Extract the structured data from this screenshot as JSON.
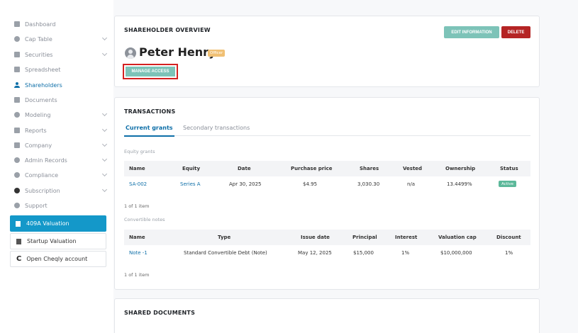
{
  "sidebar": {
    "items": [
      {
        "label": "Dashboard",
        "icon": "dashboard-icon",
        "has_chevron": false
      },
      {
        "label": "Cap Table",
        "icon": "pie-chart-icon",
        "has_chevron": true
      },
      {
        "label": "Securities",
        "icon": "document-icon",
        "has_chevron": true
      },
      {
        "label": "Spreadsheet",
        "icon": "spreadsheet-icon",
        "has_chevron": false
      },
      {
        "label": "Shareholders",
        "icon": "person-icon",
        "has_chevron": false
      },
      {
        "label": "Documents",
        "icon": "folder-icon",
        "has_chevron": false
      },
      {
        "label": "Modeling",
        "icon": "lightbulb-icon",
        "has_chevron": true
      },
      {
        "label": "Reports",
        "icon": "report-icon",
        "has_chevron": true
      },
      {
        "label": "Company",
        "icon": "company-icon",
        "has_chevron": true
      },
      {
        "label": "Admin Records",
        "icon": "pen-icon",
        "has_chevron": true
      },
      {
        "label": "Compliance",
        "icon": "compliance-icon",
        "has_chevron": true
      },
      {
        "label": "Subscription",
        "icon": "info-icon",
        "has_chevron": true
      },
      {
        "label": "Support",
        "icon": "support-icon",
        "has_chevron": false
      }
    ],
    "btn_409a": "409A Valuation",
    "btn_startup": "Startup Valuation",
    "btn_cheqly": "Open Cheqly account"
  },
  "overview": {
    "title": "SHAREHOLDER OVERVIEW",
    "edit_label": "EDIT INFORMATION",
    "delete_label": "DELETE",
    "name": "Peter Henry",
    "badge": "Officer",
    "manage_label": "MANAGE ACCESS"
  },
  "transactions": {
    "title": "TRANSACTIONS",
    "tabs": [
      "Current grants",
      "Secondary transactions"
    ],
    "equity_label": "Equity grants",
    "equity_headers": [
      "Name",
      "Equity",
      "Date",
      "Purchase price",
      "Shares",
      "Vested",
      "Ownership",
      "Status"
    ],
    "equity_rows": [
      {
        "name": "SA-002",
        "equity": "Series A",
        "date": "Apr 30, 2025",
        "price": "$4.95",
        "shares": "3,030.30",
        "vested": "n/a",
        "ownership": "13.4499%",
        "status": "Active"
      }
    ],
    "equity_count": "1 of 1 item",
    "convertible_label": "Convertible notes",
    "conv_headers": [
      "Name",
      "Type",
      "Issue date",
      "Principal",
      "Interest",
      "Valuation cap",
      "Discount"
    ],
    "conv_rows": [
      {
        "name": "Note -1",
        "type": "Standard Convertible Debt (Note)",
        "issue_date": "May 12, 2025",
        "principal": "$15,000",
        "interest": "1%",
        "cap": "$10,000,000",
        "discount": "1%"
      }
    ],
    "conv_count": "1 of 1 item"
  },
  "shared_documents": {
    "title": "SHARED DOCUMENTS"
  },
  "colors": {
    "accent": "#0e6fa8",
    "teal": "#7dc3b8",
    "danger": "#b52424",
    "officer": "#f0c074",
    "active": "#5cb89a",
    "primary_btn": "#1498c9"
  }
}
